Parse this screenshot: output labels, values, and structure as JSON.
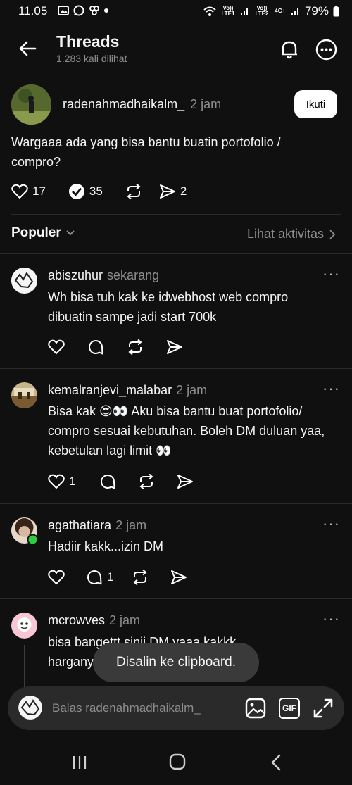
{
  "status_bar": {
    "time": "11.05",
    "battery": "79%",
    "net1": "Vo)) LTE1",
    "net2": "Vo)) LTE2",
    "net_type": "4G+"
  },
  "header": {
    "title": "Threads",
    "subtitle": "1.283 kali dilihat"
  },
  "post": {
    "username": "radenahmadhaikalm_",
    "time": "2 jam",
    "follow_label": "Ikuti",
    "text": "Wargaaa ada yang bisa bantu buatin portofolio / compro?",
    "likes": "17",
    "replies": "35",
    "reposts": "",
    "shares": "2"
  },
  "sort": {
    "label": "Populer",
    "activity_link": "Lihat aktivitas"
  },
  "replies": [
    {
      "username": "abiszuhur",
      "time": "sekarang",
      "text": "Wh bisa tuh kak ke idwebhost web compro dibuatin sampe jadi start 700k",
      "likes": "",
      "comments": ""
    },
    {
      "username": "kemalranjevi_malabar",
      "time": "2 jam",
      "text": "Bisa kak 😍👀 Aku bisa bantu buat portofolio/ compro sesuai kebutuhan. Boleh DM duluan yaa, kebetulan lagi limit 👀",
      "likes": "1",
      "comments": ""
    },
    {
      "username": "agathatiara",
      "time": "2 jam",
      "text": "Hadiir kakk...izin DM",
      "likes": "",
      "comments": "1"
    },
    {
      "username": "mcrowves",
      "time": "2 jam",
      "text": "bisa bangettt sinii DM yaaa kakkk harganya",
      "likes": "",
      "comments": ""
    }
  ],
  "toast": "Disalin ke clipboard.",
  "reply_bar": {
    "placeholder": "Balas radenahmadhaikalm_",
    "gif_label": "GIF"
  },
  "colors": {
    "background": "#101010",
    "text": "#f3f5f7",
    "muted": "#8e8e8e",
    "online": "#2ecc40"
  }
}
